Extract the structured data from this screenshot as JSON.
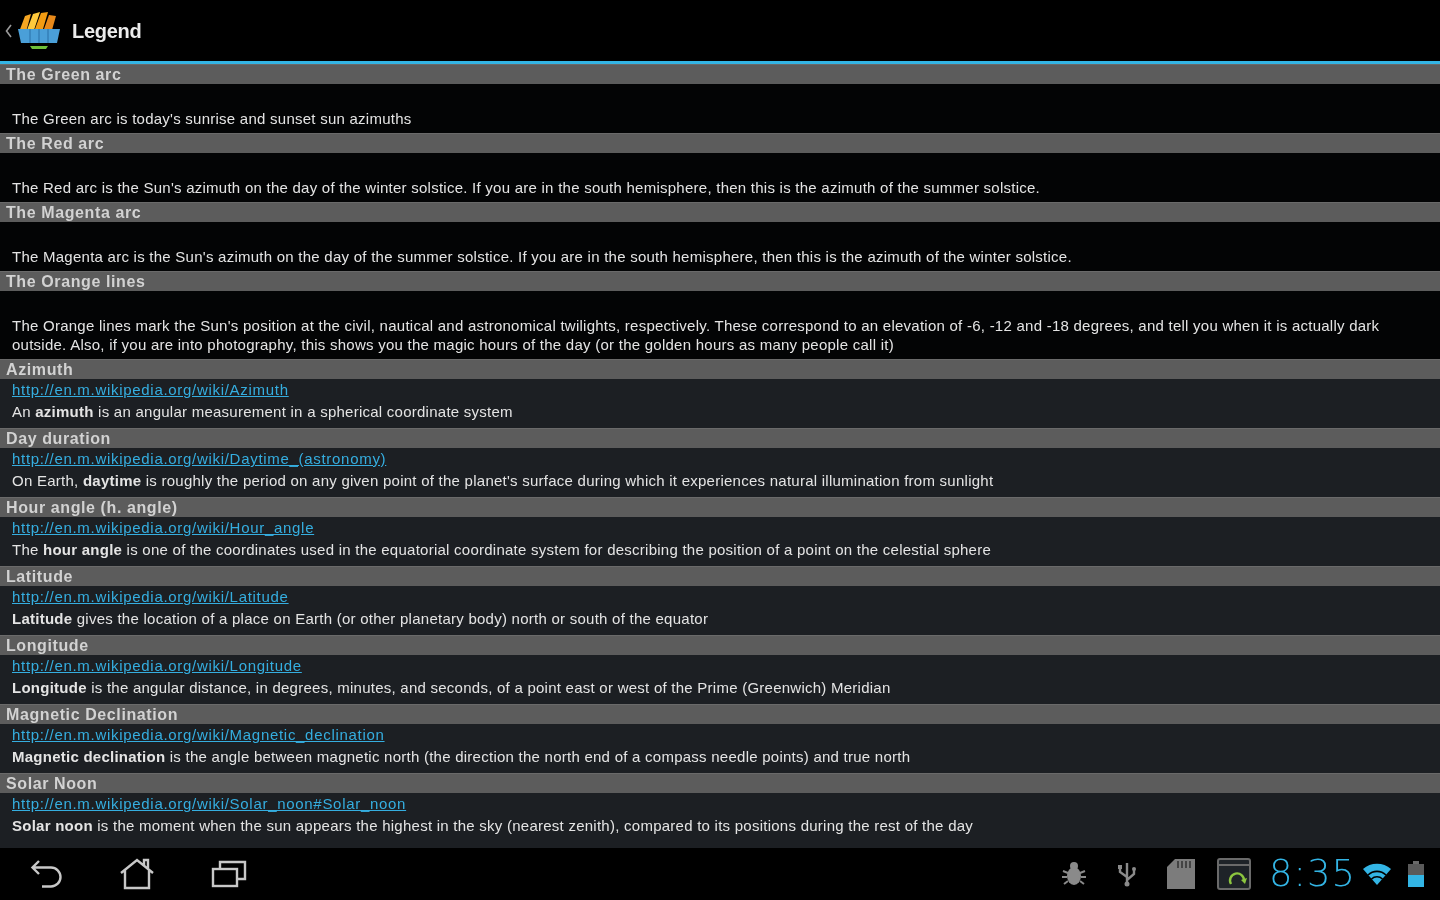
{
  "action_bar": {
    "title": "Legend"
  },
  "sections": [
    {
      "kind": "plain",
      "heading": "The Green arc",
      "text": "The Green arc is today's sunrise and sunset sun azimuths"
    },
    {
      "kind": "plain",
      "heading": "The Red arc",
      "text": "The Red arc is the Sun's azimuth on the day of the winter solstice. If you are in the south hemisphere, then this is the azimuth of the summer solstice."
    },
    {
      "kind": "plain",
      "heading": "The Magenta arc",
      "text": "The Magenta arc is the Sun's azimuth on the day of the summer solstice. If you are in the south hemisphere, then this is the azimuth of the winter solstice."
    },
    {
      "kind": "plain",
      "heading": "The Orange lines",
      "text": "The Orange lines mark the Sun's position at the civil, nautical and astronomical twilights, respectively. These correspond to an elevation of -6, -12 and -18 degrees, and tell you when it is actually dark outside. Also, if you are into photography, this shows you the magic hours of the day (or the golden hours as many people call it)"
    },
    {
      "kind": "linked",
      "heading": "Azimuth",
      "link": "http://en.m.wikipedia.org/wiki/Azimuth",
      "text": "An **azimuth** is an angular measurement in a spherical coordinate system"
    },
    {
      "kind": "linked",
      "heading": "Day duration",
      "link": "http://en.m.wikipedia.org/wiki/Daytime_(astronomy)",
      "text": "On Earth, **daytime** is roughly the period on any given point of the planet's surface during which it experiences natural illumination from sunlight"
    },
    {
      "kind": "linked",
      "heading": "Hour angle (h. angle)",
      "link": "http://en.m.wikipedia.org/wiki/Hour_angle",
      "text": "The **hour angle** is one of the coordinates used in the equatorial coordinate system for describing the position of a point on the celestial sphere"
    },
    {
      "kind": "linked",
      "heading": "Latitude",
      "link": "http://en.m.wikipedia.org/wiki/Latitude",
      "text": "**Latitude** gives the location of a place on Earth (or other planetary body) north or south of the equator"
    },
    {
      "kind": "linked",
      "heading": "Longitude",
      "link": "http://en.m.wikipedia.org/wiki/Longitude",
      "text": "**Longitude** is the angular distance, in degrees, minutes, and seconds, of a point east or west of the Prime (Greenwich) Meridian"
    },
    {
      "kind": "linked",
      "heading": "Magnetic Declination",
      "link": "http://en.m.wikipedia.org/wiki/Magnetic_declination",
      "text": "**Magnetic declination** is the angle between magnetic north (the direction the north end of a compass needle points) and true north"
    },
    {
      "kind": "linked",
      "heading": "Solar Noon",
      "link": "http://en.m.wikipedia.org/wiki/Solar_noon#Solar_noon",
      "text": "**Solar noon** is the moment when the sun appears the highest in the sky (nearest zenith), compared to its positions during the rest of the day"
    }
  ],
  "system_bar": {
    "time": "8:35"
  }
}
